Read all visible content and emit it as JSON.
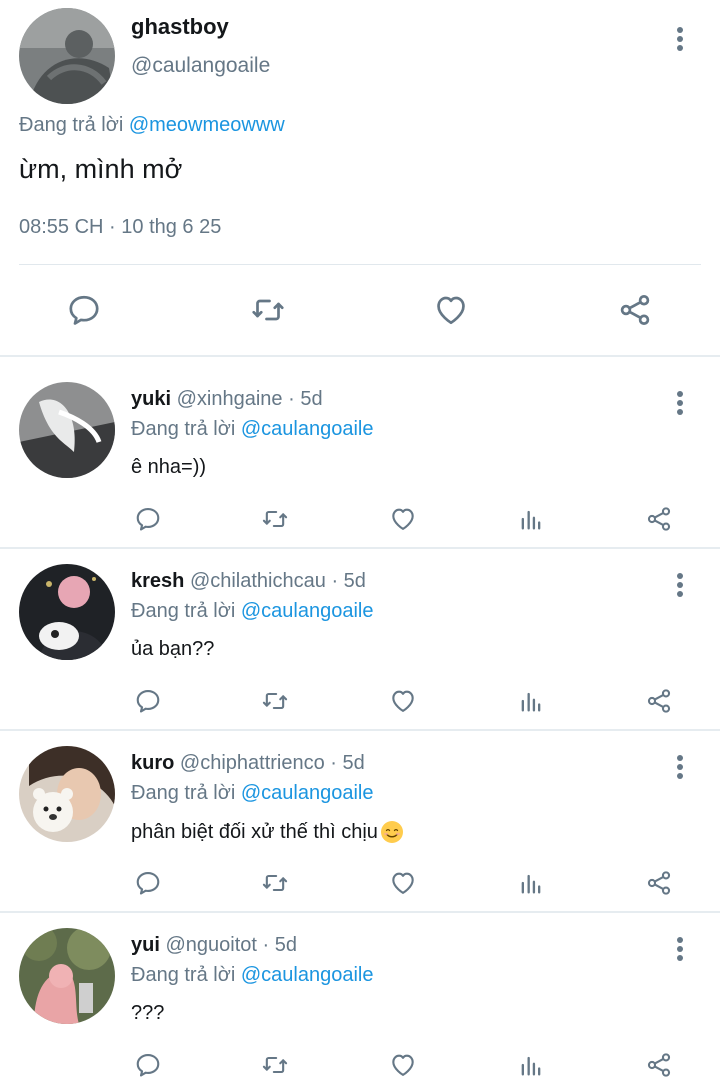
{
  "main_tweet": {
    "name": "ghastboy",
    "handle": "@caulangoaile",
    "replying_prefix": "Đang trả lời",
    "replying_to": "@meowmeowww",
    "text": "ừm, mình mở",
    "timestamp": "08:55 CH · 10 thg 6 25",
    "actions": [
      "reply-icon",
      "retweet-icon",
      "like-icon",
      "share-icon"
    ]
  },
  "replies": [
    {
      "name": "yuki",
      "handle": "@xinhgaine",
      "dot": "·",
      "time": "5d",
      "replying_prefix": "Đang trả lời",
      "replying_to": "@caulangoaile",
      "text": "ê nha=))",
      "emoji": ""
    },
    {
      "name": "kresh",
      "handle": "@chilathichcau",
      "dot": "·",
      "time": "5d",
      "replying_prefix": "Đang trả lời",
      "replying_to": "@caulangoaile",
      "text": "ủa bạn??",
      "emoji": ""
    },
    {
      "name": "kuro",
      "handle": "@chiphattrienco",
      "dot": "·",
      "time": "5d",
      "replying_prefix": "Đang trả lời",
      "replying_to": "@caulangoaile",
      "text": "phân biệt đối xử thế thì chịu",
      "emoji": "smiling-face-emoji"
    },
    {
      "name": "yui",
      "handle": "@nguoitot",
      "dot": "·",
      "time": "5d",
      "replying_prefix": "Đang trả lời",
      "replying_to": "@caulangoaile",
      "text": "???",
      "emoji": ""
    }
  ],
  "colors": {
    "link": "#1b95e0",
    "secondary_text": "#657786",
    "icon": "#657786",
    "divider": "#e6ecf0"
  }
}
